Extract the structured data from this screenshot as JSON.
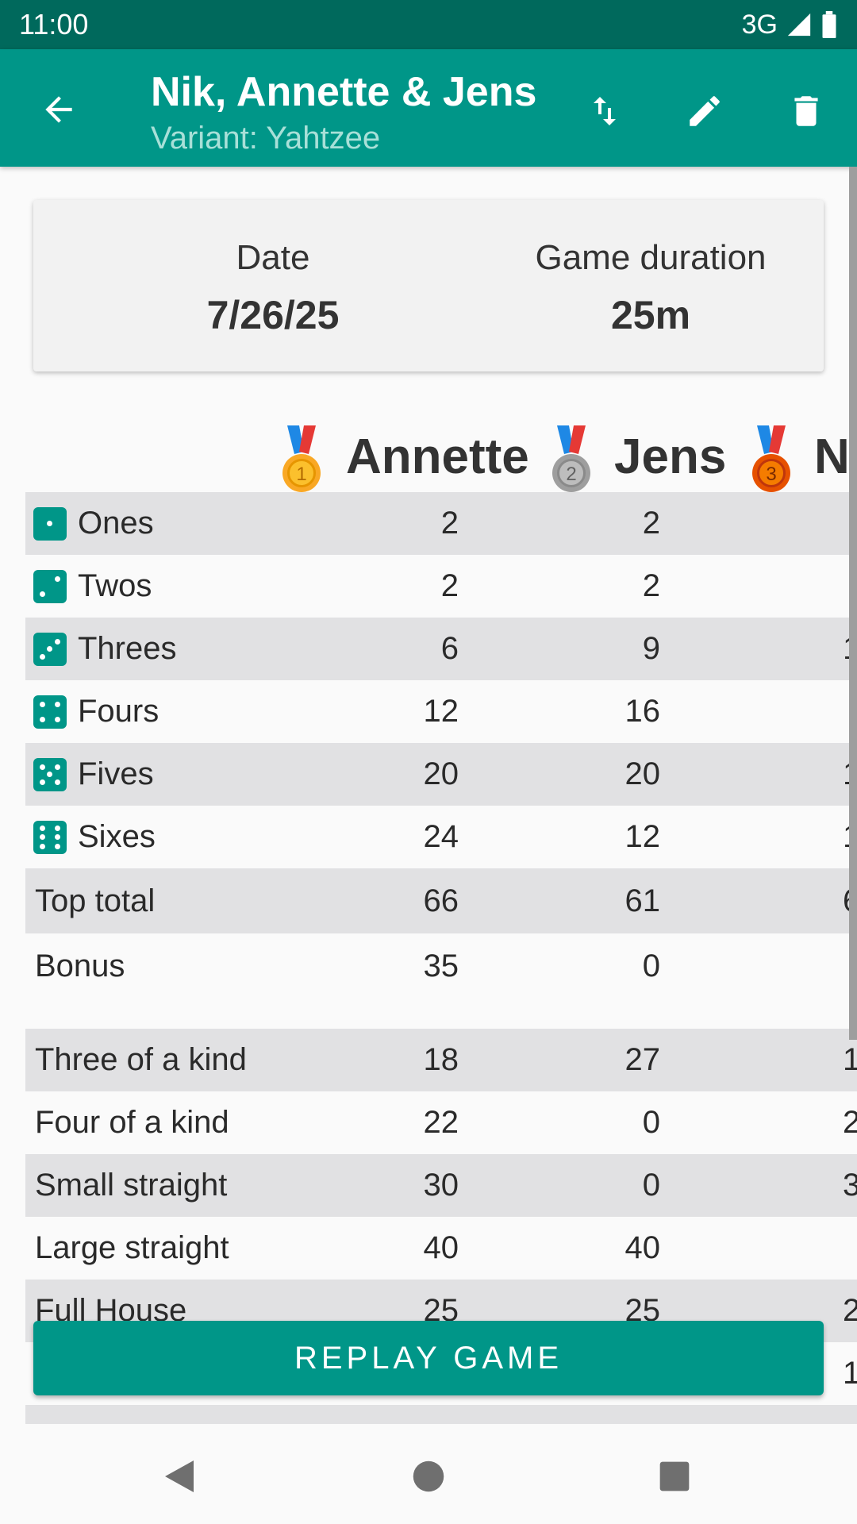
{
  "status_bar": {
    "time": "11:00",
    "network": "3G"
  },
  "app_bar": {
    "title": "Nik, Annette & Jens",
    "subtitle": "Variant: Yahtzee"
  },
  "info": {
    "date_label": "Date",
    "date_value": "7/26/25",
    "duration_label": "Game duration",
    "duration_value": "25m"
  },
  "players": [
    {
      "name": "Annette",
      "medal": "gold-medal"
    },
    {
      "name": "Jens",
      "medal": "silver-medal"
    },
    {
      "name": "Ni",
      "medal": "bronze-medal"
    }
  ],
  "rows": [
    {
      "label": "Ones",
      "die": 1,
      "v1": "2",
      "v2": "2",
      "v3": ""
    },
    {
      "label": "Twos",
      "die": 2,
      "v1": "2",
      "v2": "2",
      "v3": ""
    },
    {
      "label": "Threes",
      "die": 3,
      "v1": "6",
      "v2": "9",
      "v3": "1"
    },
    {
      "label": "Fours",
      "die": 4,
      "v1": "12",
      "v2": "16",
      "v3": ""
    },
    {
      "label": "Fives",
      "die": 5,
      "v1": "20",
      "v2": "20",
      "v3": "1"
    },
    {
      "label": "Sixes",
      "die": 6,
      "v1": "24",
      "v2": "12",
      "v3": "1"
    },
    {
      "label": "Top total",
      "v1": "66",
      "v2": "61",
      "v3": "6"
    },
    {
      "label": "Bonus",
      "v1": "35",
      "v2": "0",
      "v3": ""
    },
    {
      "label": "Three of a kind",
      "v1": "18",
      "v2": "27",
      "v3": "1"
    },
    {
      "label": "Four of a kind",
      "v1": "22",
      "v2": "0",
      "v3": "2"
    },
    {
      "label": "Small straight",
      "v1": "30",
      "v2": "0",
      "v3": "3"
    },
    {
      "label": "Large straight",
      "v1": "40",
      "v2": "40",
      "v3": ""
    },
    {
      "label": "Full House",
      "v1": "25",
      "v2": "25",
      "v3": "2"
    },
    {
      "label": "",
      "v1": "",
      "v2": "",
      "v3": "1"
    }
  ],
  "replay_label": "REPLAY GAME",
  "colors": {
    "primary": "#009688",
    "primary_dark": "#00695c",
    "row_alt": "#e1e1e3"
  }
}
